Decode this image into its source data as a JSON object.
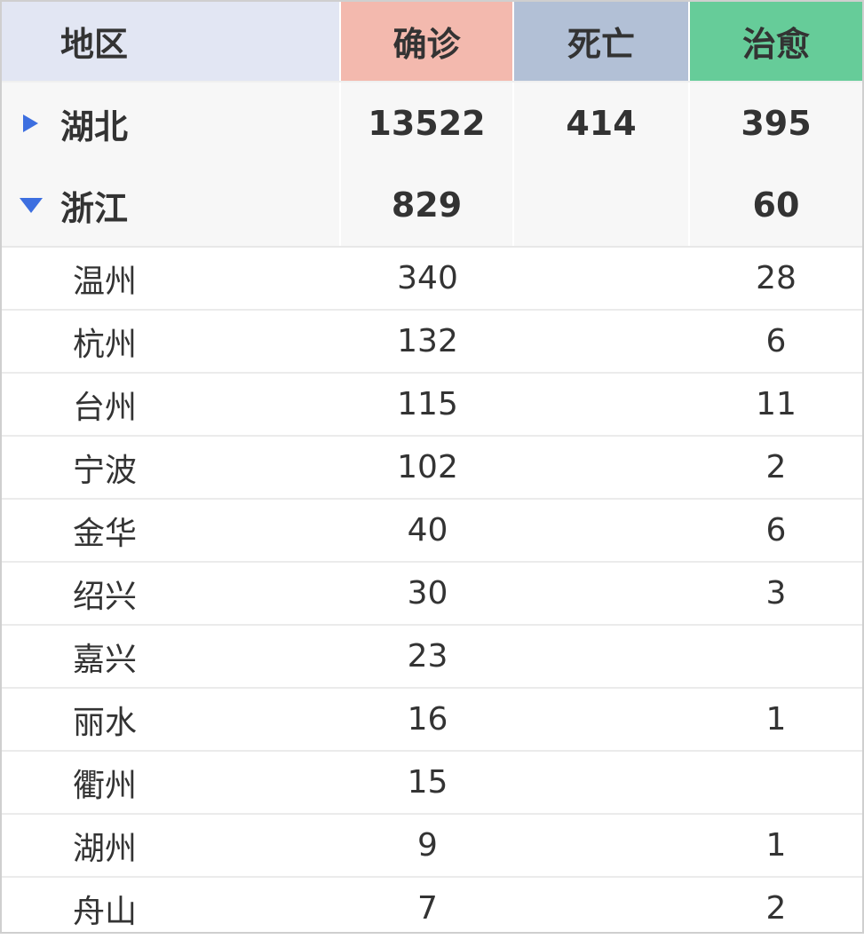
{
  "header": {
    "region": "地区",
    "confirmed": "确诊",
    "deaths": "死亡",
    "recovered": "治愈",
    "colors": {
      "region": "#e2e6f3",
      "confirmed": "#f3b9ae",
      "deaths": "#b2c0d6",
      "recovered": "#66cc99"
    }
  },
  "provinces": [
    {
      "name": "湖北",
      "confirmed": "13522",
      "deaths": "414",
      "recovered": "395",
      "expanded": false,
      "toggle_icon": "triangle-right-icon"
    },
    {
      "name": "浙江",
      "confirmed": "829",
      "deaths": "",
      "recovered": "60",
      "expanded": true,
      "toggle_icon": "triangle-down-icon"
    }
  ],
  "cities": [
    {
      "name": "温州",
      "confirmed": "340",
      "deaths": "",
      "recovered": "28"
    },
    {
      "name": "杭州",
      "confirmed": "132",
      "deaths": "",
      "recovered": "6"
    },
    {
      "name": "台州",
      "confirmed": "115",
      "deaths": "",
      "recovered": "11"
    },
    {
      "name": "宁波",
      "confirmed": "102",
      "deaths": "",
      "recovered": "2"
    },
    {
      "name": "金华",
      "confirmed": "40",
      "deaths": "",
      "recovered": "6"
    },
    {
      "name": "绍兴",
      "confirmed": "30",
      "deaths": "",
      "recovered": "3"
    },
    {
      "name": "嘉兴",
      "confirmed": "23",
      "deaths": "",
      "recovered": ""
    },
    {
      "name": "丽水",
      "confirmed": "16",
      "deaths": "",
      "recovered": "1"
    },
    {
      "name": "衢州",
      "confirmed": "15",
      "deaths": "",
      "recovered": ""
    },
    {
      "name": "湖州",
      "confirmed": "9",
      "deaths": "",
      "recovered": "1"
    },
    {
      "name": "舟山",
      "confirmed": "7",
      "deaths": "",
      "recovered": "2"
    }
  ],
  "accent_color": "#3d6fe0"
}
